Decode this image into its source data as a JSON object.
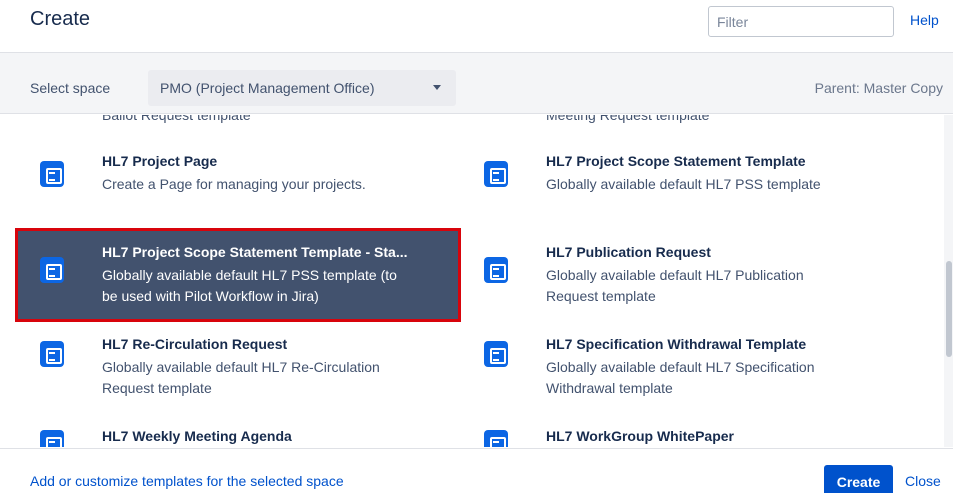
{
  "header": {
    "title": "Create",
    "filter_placeholder": "Filter",
    "help_label": "Help"
  },
  "space_bar": {
    "label": "Select space",
    "selected_space": "PMO (Project Management Office)",
    "parent_text": "Parent: Master Copy"
  },
  "templates": {
    "partial_top_left": "Ballot Request template",
    "partial_top_right": "Meeting Request template",
    "items": [
      {
        "name": "HL7 Project Page",
        "desc_1": "Create a Page for managing your projects.",
        "desc_2": ""
      },
      {
        "name": "HL7 Project Scope Statement Template",
        "desc_1": "Globally available default HL7 PSS template",
        "desc_2": ""
      },
      {
        "name": "HL7 Project Scope Statement Template - Sta...",
        "desc_1": "Globally available default HL7 PSS template (to",
        "desc_2": "be used with Pilot Workflow in Jira)"
      },
      {
        "name": "HL7 Publication Request",
        "desc_1": "Globally available default HL7 Publication",
        "desc_2": "Request template"
      },
      {
        "name": "HL7 Re-Circulation Request",
        "desc_1": "Globally available default HL7 Re-Circulation",
        "desc_2": "Request template"
      },
      {
        "name": "HL7 Specification Withdrawal Template",
        "desc_1": "Globally available default HL7 Specification",
        "desc_2": "Withdrawal template"
      },
      {
        "name": "HL7 Weekly Meeting Agenda",
        "desc_1": "",
        "desc_2": ""
      },
      {
        "name": "HL7 WorkGroup WhitePaper",
        "desc_1": "",
        "desc_2": ""
      }
    ]
  },
  "footer": {
    "customize_link": "Add or customize templates for the selected space",
    "create_label": "Create",
    "close_label": "Close"
  },
  "colors": {
    "brand_blue": "#0052cc",
    "selected_bg": "#42526e",
    "selected_border": "#d8040c",
    "icon_blue": "#0c66e4"
  }
}
